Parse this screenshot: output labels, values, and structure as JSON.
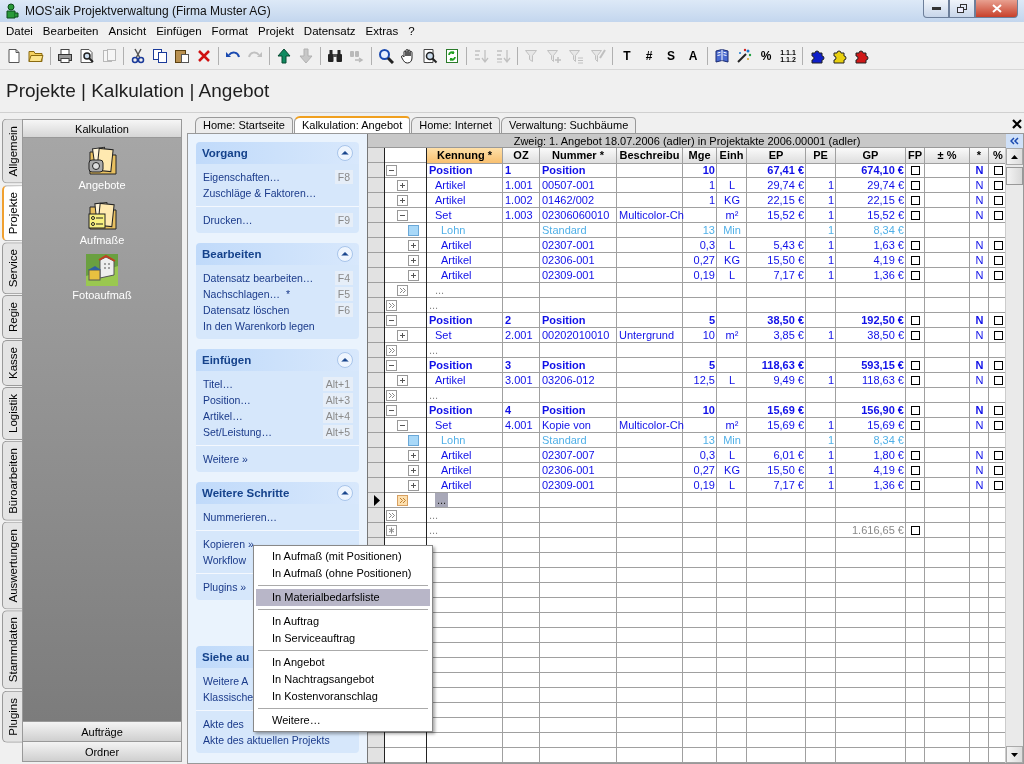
{
  "window": {
    "title": "MOS'aik Projektverwaltung (Firma Muster AG)"
  },
  "menu": [
    "Datei",
    "Bearbeiten",
    "Ansicht",
    "Einfügen",
    "Format",
    "Projekt",
    "Datensatz",
    "Extras",
    "?"
  ],
  "toolbar": [
    {
      "kind": "page",
      "disabled": false
    },
    {
      "kind": "folder",
      "disabled": false
    },
    {
      "kind": "separator"
    },
    {
      "kind": "printer",
      "disabled": false
    },
    {
      "kind": "preview",
      "disabled": false
    },
    {
      "kind": "pages",
      "disabled": true
    },
    {
      "kind": "separator"
    },
    {
      "kind": "scissors",
      "disabled": false
    },
    {
      "kind": "copy",
      "disabled": false
    },
    {
      "kind": "paste",
      "disabled": false
    },
    {
      "kind": "delete",
      "disabled": false
    },
    {
      "kind": "separator"
    },
    {
      "kind": "undo",
      "disabled": false
    },
    {
      "kind": "redo",
      "disabled": true
    },
    {
      "kind": "separator"
    },
    {
      "kind": "arrow-up",
      "disabled": false
    },
    {
      "kind": "arrow-down",
      "disabled": true
    },
    {
      "kind": "separator"
    },
    {
      "kind": "binoculars",
      "disabled": false
    },
    {
      "kind": "binoculars-arrow",
      "disabled": true
    },
    {
      "kind": "separator"
    },
    {
      "kind": "magnifier",
      "disabled": false
    },
    {
      "kind": "hand",
      "disabled": false
    },
    {
      "kind": "zoom-page",
      "disabled": false
    },
    {
      "kind": "refresh",
      "disabled": false
    },
    {
      "kind": "separator"
    },
    {
      "kind": "sort-asc",
      "disabled": true
    },
    {
      "kind": "sort-desc",
      "disabled": true
    },
    {
      "kind": "separator"
    },
    {
      "kind": "filter",
      "disabled": true
    },
    {
      "kind": "filter-plus",
      "disabled": true
    },
    {
      "kind": "filter-list",
      "disabled": true
    },
    {
      "kind": "filter-pen",
      "disabled": true
    },
    {
      "kind": "separator"
    },
    {
      "kind": "text",
      "label": "T",
      "disabled": false
    },
    {
      "kind": "text",
      "label": "#",
      "disabled": false
    },
    {
      "kind": "text",
      "label": "S",
      "disabled": false
    },
    {
      "kind": "text",
      "label": "A",
      "disabled": false
    },
    {
      "kind": "separator"
    },
    {
      "kind": "book",
      "disabled": false
    },
    {
      "kind": "wand",
      "disabled": false
    },
    {
      "kind": "text",
      "label": "%",
      "disabled": false
    },
    {
      "kind": "text-small",
      "label": "1.1.1 1.1.2",
      "disabled": false
    },
    {
      "kind": "separator"
    },
    {
      "kind": "puzzle",
      "color": "#1020c8",
      "disabled": false
    },
    {
      "kind": "puzzle",
      "color": "#e8d010",
      "disabled": false
    },
    {
      "kind": "puzzle",
      "color": "#d01818",
      "disabled": false
    }
  ],
  "breadcrumb": "Projekte | Kalkulation | Angebot",
  "side_tabs": [
    {
      "label": "Allgemein",
      "selected": false
    },
    {
      "label": "Projekte",
      "selected": true
    },
    {
      "label": "Service",
      "selected": false
    },
    {
      "label": "Regie",
      "selected": false
    },
    {
      "label": "Kasse",
      "selected": false
    },
    {
      "label": "Logistik",
      "selected": false
    },
    {
      "label": "Büroarbeiten",
      "selected": false
    },
    {
      "label": "Auswertungen",
      "selected": false
    },
    {
      "label": "Stammdaten",
      "selected": false
    },
    {
      "label": "Plugins",
      "selected": false
    }
  ],
  "navigator": {
    "title": "Kalkulation",
    "items": [
      {
        "label": "Angebote",
        "kind": "folder-phone"
      },
      {
        "label": "Aufmaße",
        "kind": "folder-form"
      },
      {
        "label": "Fotoaufmaß",
        "kind": "building"
      }
    ],
    "bottom": [
      "Aufträge",
      "Ordner"
    ]
  },
  "doc_tabs": [
    {
      "label": "Home: Startseite",
      "selected": false
    },
    {
      "label": "Kalkulation: Angebot",
      "selected": true
    },
    {
      "label": "Home: Internet",
      "selected": false
    },
    {
      "label": "Verwaltung: Suchbäume",
      "selected": false
    }
  ],
  "task_groups": [
    {
      "title": "Vorgang",
      "expanded": true,
      "sections": [
        [
          {
            "label": "Eigenschaften…",
            "shortcut": "F8"
          },
          {
            "label": "Zuschläge & Faktoren…"
          }
        ],
        [
          {
            "label": "Drucken…",
            "shortcut": "F9"
          }
        ]
      ]
    },
    {
      "title": "Bearbeiten",
      "expanded": true,
      "sections": [
        [
          {
            "label": "Datensatz bearbeiten…",
            "shortcut": "F4"
          },
          {
            "label": "Nachschlagen…  *",
            "shortcut": "F5"
          },
          {
            "label": "Datensatz löschen",
            "shortcut": "F6"
          },
          {
            "label": "In den Warenkorb legen"
          }
        ]
      ]
    },
    {
      "title": "Einfügen",
      "expanded": true,
      "sections": [
        [
          {
            "label": "Titel…",
            "shortcut": "Alt+1"
          },
          {
            "label": "Position…",
            "shortcut": "Alt+3"
          },
          {
            "label": "Artikel…",
            "shortcut": "Alt+4"
          },
          {
            "label": "Set/Leistung…",
            "shortcut": "Alt+5"
          }
        ],
        [
          {
            "label": "Weitere »"
          }
        ]
      ]
    },
    {
      "title": "Weitere Schritte",
      "expanded": true,
      "sections": [
        [
          {
            "label": "Nummerieren…"
          }
        ],
        [
          {
            "label": "Kopieren »"
          },
          {
            "label": "Workflow"
          }
        ],
        [
          {
            "label": "Plugins »"
          }
        ]
      ]
    },
    {
      "title": "Siehe au",
      "sections": [
        [
          {
            "label": "Weitere A"
          },
          {
            "label": "Klassische"
          }
        ],
        [
          {
            "label": "Akte des"
          },
          {
            "label": "Akte des aktuellen Projekts"
          }
        ]
      ]
    }
  ],
  "grid": {
    "branch": "Zweig: 1. Angebot 18.07.2006 (adler) in Projektakte 2006.00001 (adler)",
    "columns": [
      {
        "label": "Kennung *",
        "selected": true
      },
      {
        "label": "OZ",
        "selected": false
      },
      {
        "label": "Nummer *",
        "selected": false
      },
      {
        "label": "Beschreibu",
        "selected": false
      },
      {
        "label": "Mge",
        "selected": false
      },
      {
        "label": "Einh",
        "selected": false
      },
      {
        "label": "EP",
        "selected": false
      },
      {
        "label": "PE",
        "selected": false
      },
      {
        "label": "GP",
        "selected": false
      },
      {
        "label": "FP",
        "selected": false
      },
      {
        "label": "± %",
        "selected": false
      },
      {
        "label": "*",
        "selected": false
      },
      {
        "label": "%",
        "selected": false
      }
    ],
    "rows": [
      {
        "kind": "position",
        "expanded": true,
        "selected": false,
        "kennung": "Position",
        "oz": "1",
        "nummer": "Position",
        "mge": "10",
        "ep": "67,41 €",
        "gp": "674,10 €",
        "fp": false,
        "flag": "N",
        "percent": false,
        "children": [
          {
            "kind": "article",
            "expanded": false,
            "selected": false,
            "kennung": "Artikel",
            "oz": "1.001",
            "nummer": "00507-001",
            "mge": "1",
            "einh": "L",
            "ep": "29,74 €",
            "pe": "1",
            "gp": "29,74 €",
            "fp": false,
            "flag": "N",
            "percent": false
          },
          {
            "kind": "article",
            "expanded": false,
            "selected": false,
            "kennung": "Artikel",
            "oz": "1.002",
            "nummer": "01462/002",
            "mge": "1",
            "einh": "KG",
            "ep": "22,15 €",
            "pe": "1",
            "gp": "22,15 €",
            "fp": false,
            "flag": "N",
            "percent": false
          },
          {
            "kind": "article",
            "expanded": true,
            "selected": false,
            "kennung": "Set",
            "oz": "1.003",
            "nummer": "02306060010",
            "beschreibung": "Multicolor-Ch",
            "einh": "m²",
            "ep": "15,52 €",
            "pe": "1",
            "gp": "15,52 €",
            "fp": false,
            "flag": "N",
            "percent": false,
            "children": [
              {
                "kind": "labor",
                "selected": false,
                "kennung": "Lohn",
                "nummer": "Standard",
                "mge": "13",
                "einh": "Min",
                "pe": "1",
                "gp": "8,34 €"
              },
              {
                "kind": "article",
                "expanded": false,
                "selected": false,
                "kennung": "Artikel",
                "nummer": "02307-001",
                "mge": "0,3",
                "einh": "L",
                "ep": "5,43 €",
                "pe": "1",
                "gp": "1,63 €",
                "fp": false,
                "flag": "N",
                "percent": false
              },
              {
                "kind": "article",
                "expanded": false,
                "selected": false,
                "kennung": "Artikel",
                "nummer": "02306-001",
                "mge": "0,27",
                "einh": "KG",
                "ep": "15,50 €",
                "pe": "1",
                "gp": "4,19 €",
                "fp": false,
                "flag": "N",
                "percent": false
              },
              {
                "kind": "article",
                "expanded": false,
                "selected": false,
                "kennung": "Artikel",
                "nummer": "02309-001",
                "mge": "0,19",
                "einh": "L",
                "ep": "7,17 €",
                "pe": "1",
                "gp": "1,36 €",
                "fp": false,
                "flag": "N",
                "percent": false
              }
            ]
          },
          {
            "kind": "more",
            "selected": false,
            "kennung": "..."
          }
        ]
      },
      {
        "kind": "more",
        "selected": false,
        "kennung": "..."
      },
      {
        "kind": "position",
        "expanded": true,
        "selected": false,
        "kennung": "Position",
        "oz": "2",
        "nummer": "Position",
        "mge": "5",
        "ep": "38,50 €",
        "gp": "192,50 €",
        "fp": false,
        "flag": "N",
        "percent": false,
        "children": [
          {
            "kind": "article",
            "expanded": false,
            "selected": false,
            "kennung": "Set",
            "oz": "2.001",
            "nummer": "00202010010",
            "beschreibung": "Untergrund",
            "mge": "10",
            "einh": "m²",
            "ep": "3,85 €",
            "pe": "1",
            "gp": "38,50 €",
            "fp": false,
            "flag": "N",
            "percent": false
          }
        ]
      },
      {
        "kind": "more",
        "selected": false,
        "kennung": "..."
      },
      {
        "kind": "position",
        "expanded": true,
        "selected": false,
        "kennung": "Position",
        "oz": "3",
        "nummer": "Position",
        "mge": "5",
        "ep": "118,63 €",
        "gp": "593,15 €",
        "fp": false,
        "flag": "N",
        "percent": false,
        "children": [
          {
            "kind": "article",
            "expanded": false,
            "selected": false,
            "kennung": "Artikel",
            "oz": "3.001",
            "nummer": "03206-012",
            "mge": "12,5",
            "einh": "L",
            "ep": "9,49 €",
            "pe": "1",
            "gp": "118,63 €",
            "fp": false,
            "flag": "N",
            "percent": false
          }
        ]
      },
      {
        "kind": "more",
        "selected": false,
        "kennung": "..."
      },
      {
        "kind": "position",
        "expanded": true,
        "selected": false,
        "kennung": "Position",
        "oz": "4",
        "nummer": "Position",
        "mge": "10",
        "ep": "15,69 €",
        "gp": "156,90 €",
        "fp": false,
        "flag": "N",
        "percent": false,
        "children": [
          {
            "kind": "article",
            "expanded": true,
            "selected": false,
            "kennung": "Set",
            "oz": "4.001",
            "nummer": "Kopie von",
            "beschreibung": "Multicolor-Ch",
            "einh": "m²",
            "ep": "15,69 €",
            "pe": "1",
            "gp": "15,69 €",
            "fp": false,
            "flag": "N",
            "percent": false,
            "children": [
              {
                "kind": "labor",
                "selected": false,
                "kennung": "Lohn",
                "nummer": "Standard",
                "mge": "13",
                "einh": "Min",
                "pe": "1",
                "gp": "8,34 €"
              },
              {
                "kind": "article",
                "expanded": false,
                "selected": false,
                "kennung": "Artikel",
                "nummer": "02307-007",
                "mge": "0,3",
                "einh": "L",
                "ep": "6,01 €",
                "pe": "1",
                "gp": "1,80 €",
                "fp": false,
                "flag": "N",
                "percent": false
              },
              {
                "kind": "article",
                "expanded": false,
                "selected": false,
                "kennung": "Artikel",
                "nummer": "02306-001",
                "mge": "0,27",
                "einh": "KG",
                "ep": "15,50 €",
                "pe": "1",
                "gp": "4,19 €",
                "fp": false,
                "flag": "N",
                "percent": false
              },
              {
                "kind": "article",
                "expanded": false,
                "selected": false,
                "kennung": "Artikel",
                "nummer": "02309-001",
                "mge": "0,19",
                "einh": "L",
                "ep": "7,17 €",
                "pe": "1",
                "gp": "1,36 €",
                "fp": false,
                "flag": "N",
                "percent": false
              }
            ]
          },
          {
            "kind": "more",
            "selected": true,
            "kennung": "..."
          }
        ]
      },
      {
        "kind": "more",
        "selected": false,
        "kennung": "..."
      },
      {
        "kind": "total",
        "selected": false,
        "kennung": "...",
        "gp": "1.616,65 €",
        "fp": false
      }
    ]
  },
  "context_menu": [
    [
      {
        "label": "In Aufmaß (mit Positionen)",
        "selected": false
      },
      {
        "label": "In Aufmaß (ohne Positionen)",
        "selected": false
      }
    ],
    [
      {
        "label": "In Materialbedarfsliste",
        "selected": true
      }
    ],
    [
      {
        "label": "In Auftrag",
        "selected": false
      },
      {
        "label": "In Serviceauftrag",
        "selected": false
      }
    ],
    [
      {
        "label": "In Angebot",
        "selected": false
      },
      {
        "label": "In Nachtragsangebot",
        "selected": false
      },
      {
        "label": "In Kostenvoranschlag",
        "selected": false
      }
    ],
    [
      {
        "label": "Weitere…",
        "selected": false
      }
    ]
  ]
}
